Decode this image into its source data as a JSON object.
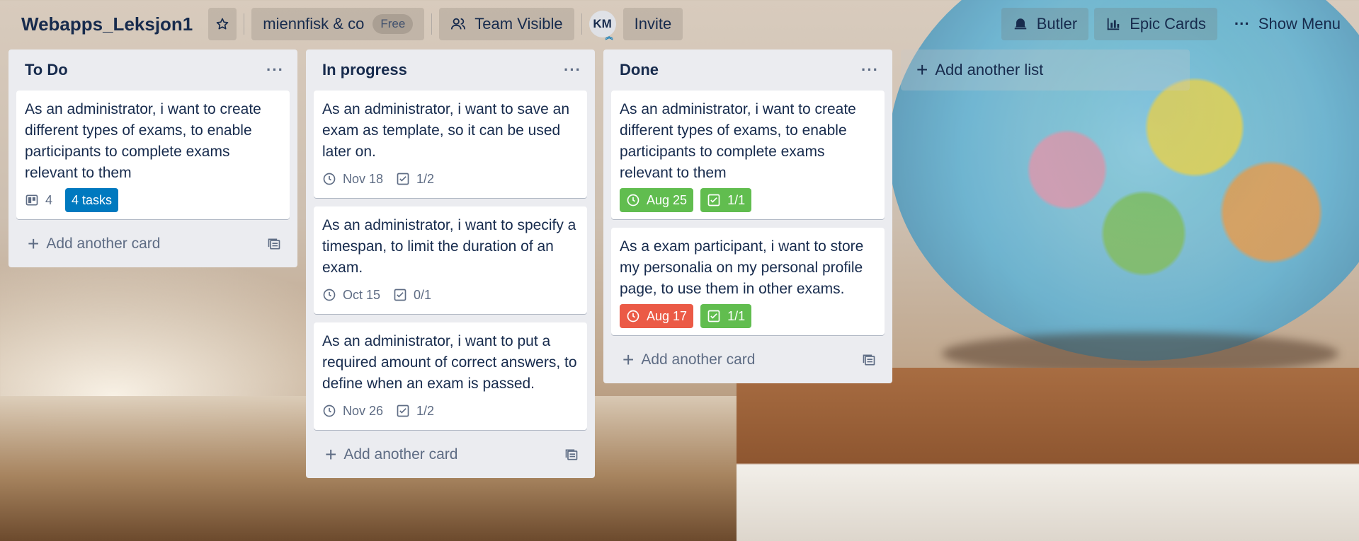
{
  "header": {
    "board_title": "Webapps_Leksjon1",
    "team_name": "miennfisk & co",
    "team_plan": "Free",
    "visibility": "Team Visible",
    "avatar_initials": "KM",
    "invite": "Invite",
    "butler": "Butler",
    "epic_cards": "Epic Cards",
    "show_menu": "Show Menu",
    "star_icon": "star-icon",
    "visibility_icon": "team-icon",
    "butler_icon": "bell-icon",
    "epic_icon": "bar-chart-icon",
    "menu_icon": "more-icon"
  },
  "lists": [
    {
      "title": "To Do",
      "menu": "···",
      "add_card": "Add another card",
      "cards": [
        {
          "text": "As an administrator, i want to create different types of exams, to enable participants to complete exams relevant to them",
          "count": "4",
          "label": "4 tasks"
        }
      ]
    },
    {
      "title": "In progress",
      "menu": "···",
      "add_card": "Add another card",
      "cards": [
        {
          "text": "As an administrator, i want to save an exam as template, so it can be used later on.",
          "due": "Nov 18",
          "checklist": "1/2"
        },
        {
          "text": "As an administrator, i want to specify a timespan, to limit the duration of an exam.",
          "due": "Oct 15",
          "checklist": "0/1"
        },
        {
          "text": "As an administrator, i want to put a required amount of correct answers, to define when an exam is passed.",
          "due": "Nov 26",
          "checklist": "1/2"
        }
      ]
    },
    {
      "title": "Done",
      "menu": "···",
      "add_card": "Add another card",
      "cards": [
        {
          "text": "As an administrator, i want to create different types of exams, to enable participants to complete exams relevant to them",
          "due": "Aug 25",
          "checklist": "1/1"
        },
        {
          "text": "As a exam participant, i want to store my personalia on my personal profile page, to use them in other exams.",
          "due": "Aug 17",
          "checklist": "1/1"
        }
      ]
    }
  ],
  "add_list": "Add another list",
  "colors": {
    "due_complete": "#61bd4f",
    "due_overdue": "#eb5a46",
    "label_blue": "#0079bf",
    "list_bg": "#ebecf0"
  }
}
